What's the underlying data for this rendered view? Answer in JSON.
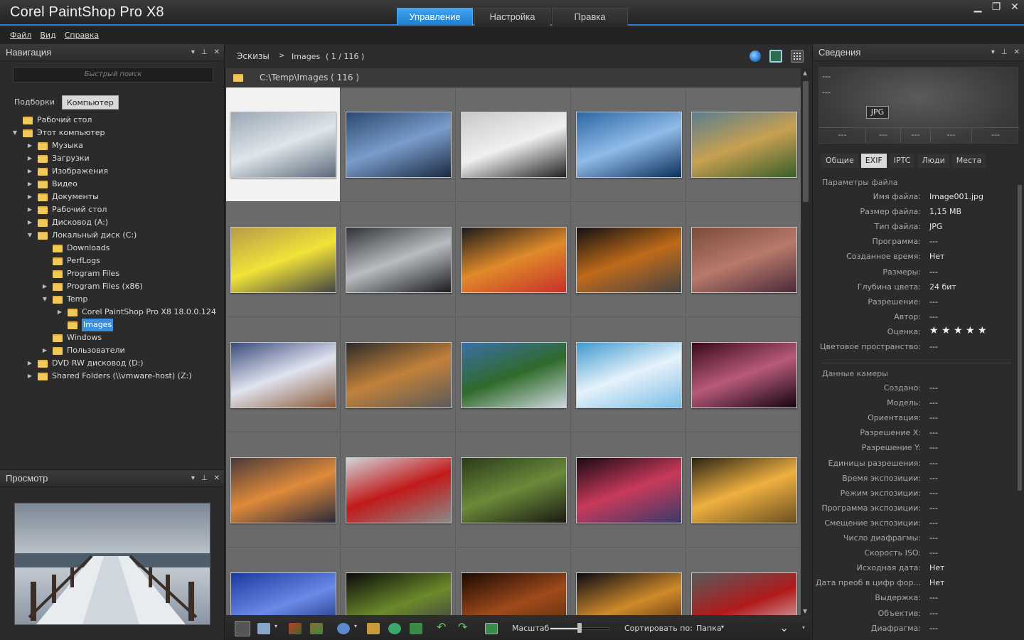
{
  "app": {
    "title": "Corel PaintShop Pro X8"
  },
  "mode_tabs": [
    {
      "label": "Управление",
      "active": true
    },
    {
      "label": "Настройка",
      "active": false
    },
    {
      "label": "Правка",
      "active": false
    }
  ],
  "menu": [
    "Файл",
    "Вид",
    "Справка"
  ],
  "nav": {
    "title": "Навигация",
    "search_placeholder": "Быстрый поиск",
    "tabs": [
      {
        "label": "Подборки",
        "active": false
      },
      {
        "label": "Компьютер",
        "active": true
      }
    ],
    "tree": [
      {
        "label": "Рабочий стол",
        "arrow": ""
      },
      {
        "label": "Этот компьютер",
        "arrow": "▼"
      },
      {
        "label": "Музыка",
        "arrow": "▶"
      },
      {
        "label": "Загрузки",
        "arrow": "▶"
      },
      {
        "label": "Изображения",
        "arrow": "▶"
      },
      {
        "label": "Видео",
        "arrow": "▶"
      },
      {
        "label": "Документы",
        "arrow": "▶"
      },
      {
        "label": "Рабочий стол",
        "arrow": "▶"
      },
      {
        "label": "Дисковод (A:)",
        "arrow": "▶"
      },
      {
        "label": "Локальный диск (C:)",
        "arrow": "▼"
      },
      {
        "label": "Downloads",
        "arrow": ""
      },
      {
        "label": "PerfLogs",
        "arrow": ""
      },
      {
        "label": "Program Files",
        "arrow": ""
      },
      {
        "label": "Program Files (x86)",
        "arrow": "▶"
      },
      {
        "label": "Temp",
        "arrow": "▼"
      },
      {
        "label": "Corel PaintShop Pro X8 18.0.0.124",
        "arrow": "▶"
      },
      {
        "label": "Images",
        "arrow": "",
        "selected": true
      },
      {
        "label": "Windows",
        "arrow": ""
      },
      {
        "label": "Пользователи",
        "arrow": "▶"
      },
      {
        "label": "DVD RW дисковод (D:)",
        "arrow": "▶"
      },
      {
        "label": "Shared Folders (\\\\vmware-host) (Z:)",
        "arrow": "▶"
      }
    ]
  },
  "preview": {
    "title": "Просмотр"
  },
  "browser": {
    "crumb_root": "Эскизы",
    "crumb_sep": ">",
    "crumb_folder": "Images",
    "crumb_count": "( 1 / 116 )",
    "path": "C:\\Temp\\Images ( 116 )"
  },
  "thumbnails": [
    {
      "name": "pier-snow",
      "colors": [
        "#9aa7b5",
        "#dfe5ea",
        "#5b6a7a"
      ]
    },
    {
      "name": "storm-sea",
      "colors": [
        "#2b4a6e",
        "#7a9ccb",
        "#1a2a40"
      ]
    },
    {
      "name": "surface-tablet",
      "colors": [
        "#c9c9c9",
        "#f0f0f0",
        "#222"
      ]
    },
    {
      "name": "mountain-lake",
      "colors": [
        "#2d66a5",
        "#8fbbe8",
        "#0b2f5a"
      ]
    },
    {
      "name": "meadow-valley",
      "colors": [
        "#5a7e8c",
        "#c8a052",
        "#375e2a"
      ]
    },
    {
      "name": "yellow-car",
      "colors": [
        "#b89a4a",
        "#f1e338",
        "#444"
      ]
    },
    {
      "name": "white-tiger",
      "colors": [
        "#2f3338",
        "#b9bcc0",
        "#1a1c1f"
      ]
    },
    {
      "name": "fruits",
      "colors": [
        "#1a1a1a",
        "#e08a2a",
        "#c6302a"
      ]
    },
    {
      "name": "bottles",
      "colors": [
        "#111",
        "#c06a1a",
        "#444"
      ]
    },
    {
      "name": "girl-field",
      "colors": [
        "#7a4a3a",
        "#b87a6a",
        "#4a2a3a"
      ]
    },
    {
      "name": "wolf-snow",
      "colors": [
        "#3a4a7a",
        "#e0e4f0",
        "#8a5a3a"
      ]
    },
    {
      "name": "beach-sunset",
      "colors": [
        "#2b2b2b",
        "#c2813a",
        "#5a5a5a"
      ]
    },
    {
      "name": "alps",
      "colors": [
        "#3b6ea8",
        "#2f6a2a",
        "#cfd8e0"
      ]
    },
    {
      "name": "sky-clouds",
      "colors": [
        "#3f9ad0",
        "#e6f2fb",
        "#7bbde6"
      ]
    },
    {
      "name": "space-nebula",
      "colors": [
        "#3a0a1a",
        "#b85a7a",
        "#120410"
      ]
    },
    {
      "name": "sunset-rocks",
      "colors": [
        "#4a3a3a",
        "#e08a3a",
        "#2a2a3a"
      ]
    },
    {
      "name": "red-porsche",
      "colors": [
        "#cfd5d9",
        "#c21a1a",
        "#8a8a8a"
      ]
    },
    {
      "name": "forest-stream",
      "colors": [
        "#2a3a1a",
        "#6a8a3a",
        "#1a1a12"
      ]
    },
    {
      "name": "planet-space",
      "colors": [
        "#1a0a14",
        "#c83a5a",
        "#3a3a6a"
      ]
    },
    {
      "name": "field-sunset",
      "colors": [
        "#2a2414",
        "#f0b040",
        "#6a5020"
      ]
    },
    {
      "name": "blue-abstract",
      "colors": [
        "#1a3aa0",
        "#6a8ae8",
        "#0a1a60"
      ]
    },
    {
      "name": "fireworks",
      "colors": [
        "#0a0a0a",
        "#6a8a2a",
        "#3a2a4a"
      ]
    },
    {
      "name": "autumn-tree",
      "colors": [
        "#1a0a04",
        "#a04a1a",
        "#4a2a0a"
      ]
    },
    {
      "name": "night-town",
      "colors": [
        "#0a0a14",
        "#d08a2a",
        "#3a1a0a"
      ]
    },
    {
      "name": "red-peppers",
      "colors": [
        "#5a5a5a",
        "#b01a1a",
        "#dcdcdc"
      ]
    }
  ],
  "bottom_toolbar": {
    "zoom_label": "Масштаб",
    "zoom_value": 0.5,
    "sort_label": "Сортировать по:",
    "sort_value": "Папка"
  },
  "info": {
    "title": "Сведения",
    "box": {
      "line1": "---",
      "line2": "---",
      "format": "JPG",
      "fields": [
        "---",
        "---",
        "---",
        "---",
        "---"
      ]
    },
    "tabs": [
      {
        "label": "Общие",
        "active": false
      },
      {
        "label": "EXIF",
        "active": true
      },
      {
        "label": "IPTC",
        "active": false
      },
      {
        "label": "Люди",
        "active": false
      },
      {
        "label": "Места",
        "active": false
      }
    ],
    "file_section": "Параметры файла",
    "file_rows": [
      {
        "k": "Имя файла:",
        "v": "Image001.jpg"
      },
      {
        "k": "Размер файла:",
        "v": "1,15 MB"
      },
      {
        "k": "Тип файла:",
        "v": "JPG"
      },
      {
        "k": "Программа:",
        "v": "---"
      },
      {
        "k": "Созданное время:",
        "v": "Нет"
      },
      {
        "k": "Размеры:",
        "v": "---"
      },
      {
        "k": "Глубина цвета:",
        "v": "24 бит"
      },
      {
        "k": "Разрешение:",
        "v": "---"
      },
      {
        "k": "Автор:",
        "v": "---"
      },
      {
        "k": "Оценка:",
        "v": "★ ★ ★ ★ ★"
      },
      {
        "k": "Цветовое пространство:",
        "v": "---"
      }
    ],
    "camera_section": "Данные камеры",
    "camera_rows": [
      {
        "k": "Создано:",
        "v": "---"
      },
      {
        "k": "Модель:",
        "v": "---"
      },
      {
        "k": "Ориентация:",
        "v": "---"
      },
      {
        "k": "Разрешение X:",
        "v": "---"
      },
      {
        "k": "Разрешение Y:",
        "v": "---"
      },
      {
        "k": "Единицы разрешения:",
        "v": "---"
      },
      {
        "k": "Время экспозиции:",
        "v": "---"
      },
      {
        "k": "Режим экспозиции:",
        "v": "---"
      },
      {
        "k": "Программа экспозиции:",
        "v": "---"
      },
      {
        "k": "Смещение экспозиции:",
        "v": "---"
      },
      {
        "k": "Число диафрагмы:",
        "v": "---"
      },
      {
        "k": "Скорость ISO:",
        "v": "---"
      },
      {
        "k": "Исходная дата:",
        "v": "Нет"
      },
      {
        "k": "Дата преоб в цифр фор...",
        "v": "Нет"
      },
      {
        "k": "Выдержка:",
        "v": "---"
      },
      {
        "k": "Объектив:",
        "v": "---"
      },
      {
        "k": "Диафрагма:",
        "v": "---"
      }
    ]
  }
}
